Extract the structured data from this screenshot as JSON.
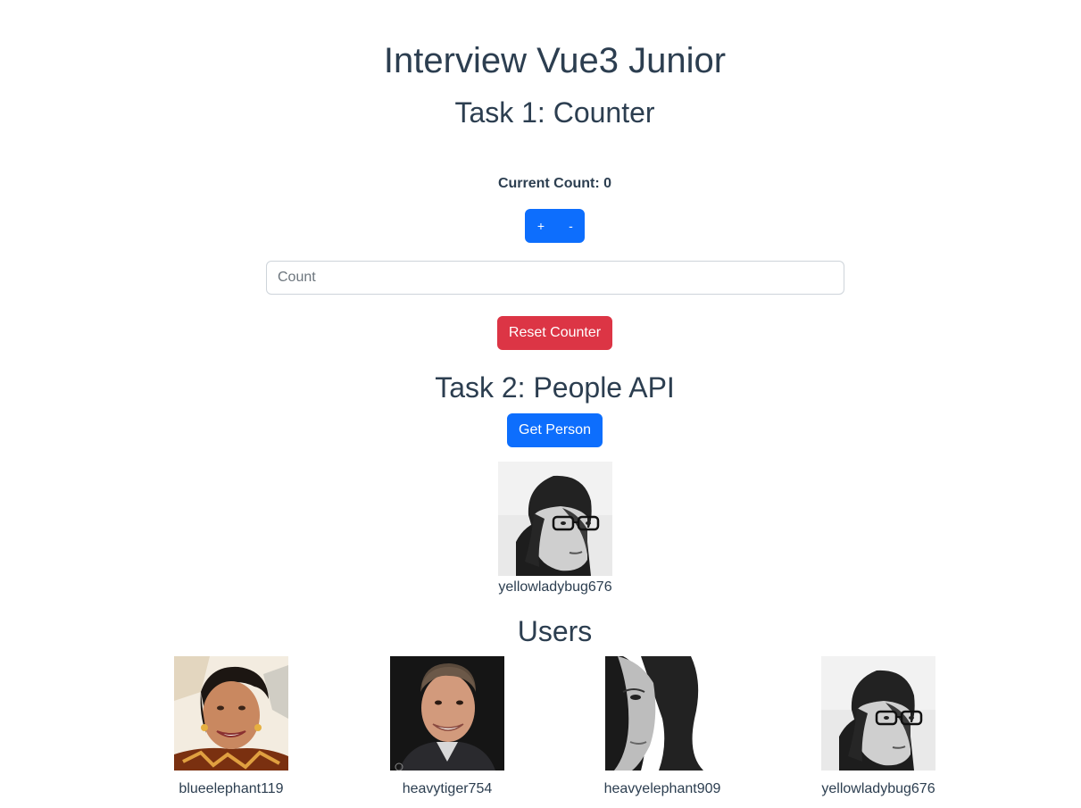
{
  "app": {
    "title": "Interview Vue3 Junior"
  },
  "task1": {
    "heading": "Task 1: Counter",
    "count_label": "Current Count: 0",
    "increment_label": "+",
    "decrement_label": "-",
    "count_input": {
      "placeholder": "Count",
      "value": ""
    },
    "reset_label": "Reset Counter"
  },
  "task2": {
    "heading": "Task 2: People API",
    "get_person_label": "Get Person",
    "person": {
      "username": "yellowladybug676"
    }
  },
  "users": {
    "heading": "Users",
    "items": [
      {
        "username": "blueelephant119"
      },
      {
        "username": "heavytiger754"
      },
      {
        "username": "heavyelephant909"
      },
      {
        "username": "yellowladybug676"
      }
    ]
  },
  "colors": {
    "text": "#2c3e50",
    "primary": "#0d6efd",
    "danger": "#dc3545",
    "input_border": "#ced4da"
  }
}
